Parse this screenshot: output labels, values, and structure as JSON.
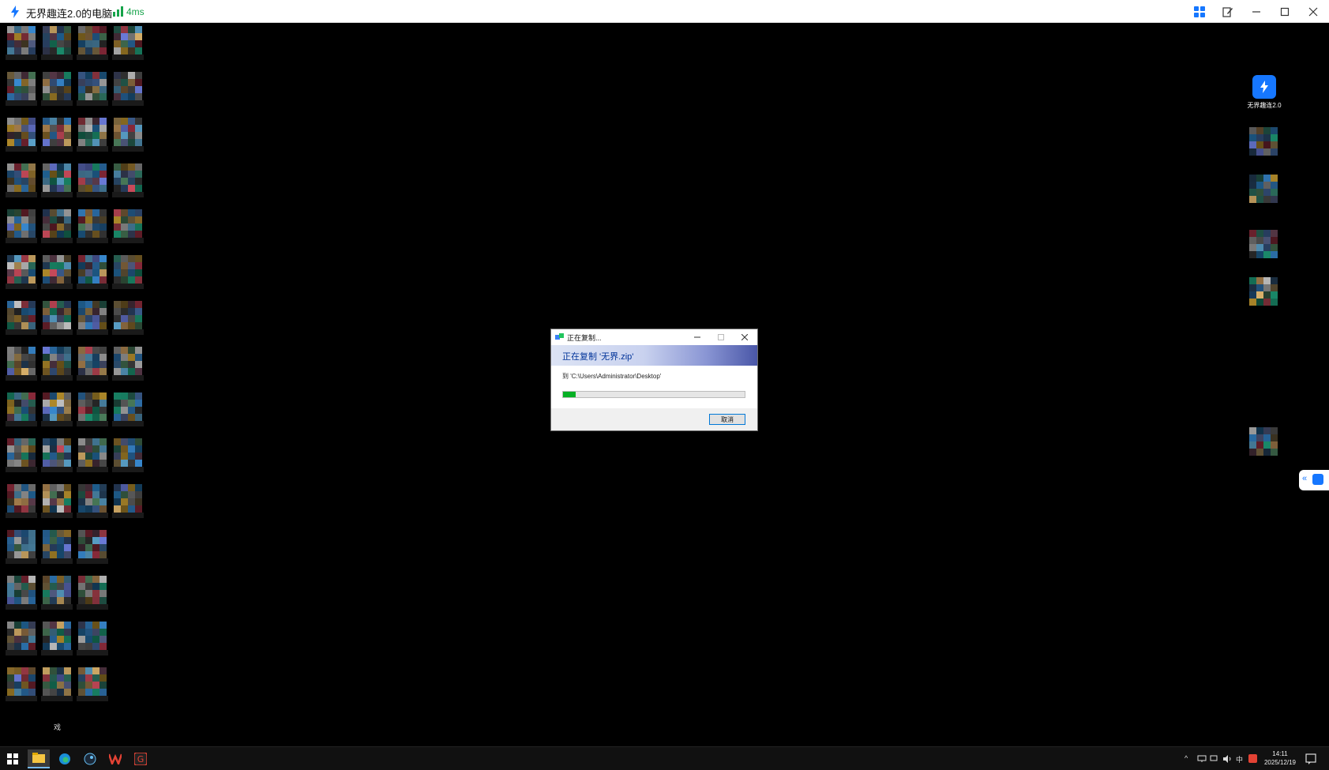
{
  "window": {
    "title": "无界趣连2.0的电脑",
    "latency": "4ms",
    "controls": [
      "apps-grid-icon",
      "edit-note-icon",
      "minimize-icon",
      "maximize-icon",
      "close-icon"
    ]
  },
  "desktop": {
    "app_shortcut_label": "无界趣连2.0",
    "bottom_caption": "戏"
  },
  "copy_dialog": {
    "title": "正在复制...",
    "header": "正在复制 '无界.zip'",
    "destination": "到 'C:\\Users\\Administrator\\Desktop'",
    "progress_fraction": 0.07,
    "cancel_label": "取消"
  },
  "taskbar": {
    "apps": [
      "windows-start-icon",
      "file-explorer-icon",
      "edge-icon",
      "steam-icon",
      "wps-icon",
      "g-app-icon"
    ],
    "tray": {
      "ime": "中"
    },
    "time": "14:11",
    "date": "2025/12/19"
  },
  "colors": {
    "accent": "#1677ff",
    "latency": "#16a34a",
    "progress": "#06b025"
  }
}
